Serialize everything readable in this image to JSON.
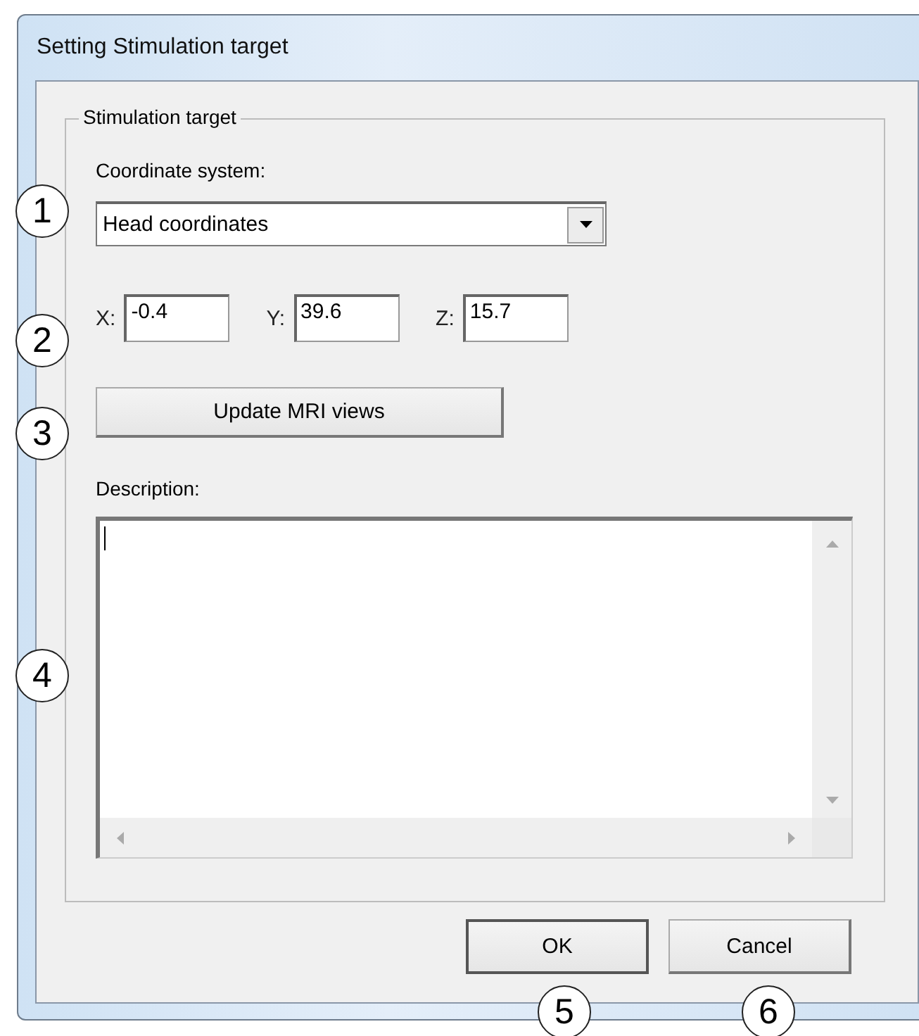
{
  "window": {
    "title": "Setting Stimulation target"
  },
  "group": {
    "label": "Stimulation target"
  },
  "coordinate_system": {
    "label": "Coordinate system:",
    "value": "Head coordinates"
  },
  "coordinates": [
    {
      "label": "X:",
      "value": "-0.4"
    },
    {
      "label": "Y:",
      "value": "39.6"
    },
    {
      "label": "Z:",
      "value": "15.7"
    }
  ],
  "update_button": "Update MRI views",
  "description": {
    "label": "Description:"
  },
  "buttons": [
    {
      "label": "OK",
      "default": true
    },
    {
      "label": "Cancel",
      "default": false
    }
  ],
  "callouts": [
    "1",
    "2",
    "3",
    "4",
    "5",
    "6"
  ]
}
